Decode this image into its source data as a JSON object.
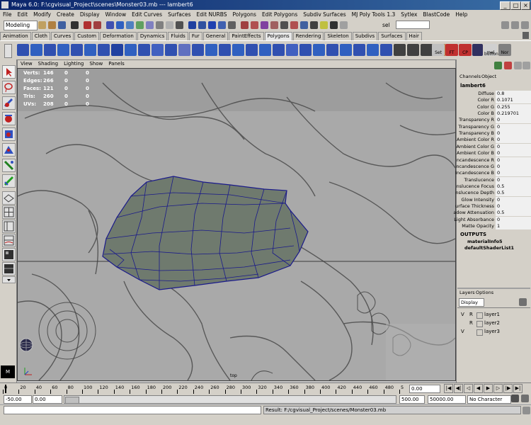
{
  "window": {
    "title": "Maya 6.0: F:\\cgvisual_Project\\scenes\\Monster03.mb  ---  lambert6"
  },
  "menu": [
    "File",
    "Edit",
    "Modify",
    "Create",
    "Display",
    "Window",
    "Edit Curves",
    "Surfaces",
    "Edit NURBS",
    "Polygons",
    "Edit Polygons",
    "Subdiv Surfaces",
    "MJ Poly Tools 1.3",
    "Sytlex",
    "BlastCode",
    "Help"
  ],
  "status": {
    "mode": "Modeling",
    "sel_label": "sel"
  },
  "shelf_tabs": [
    "Animation",
    "Cloth",
    "Curves",
    "Custom",
    "Deformation",
    "Dynamics",
    "Fluids",
    "Fur",
    "General",
    "PaintEffects",
    "Polygons",
    "Rendering",
    "Skeleton",
    "Subdivs",
    "Surfaces",
    "Hair"
  ],
  "shelf_active": "Polygons",
  "shelf_text_icons": {
    "set": "Set",
    "ft": "FT",
    "cp": "CP",
    "mel": "mel",
    "button": "button",
    "nor": "Nor"
  },
  "panel_menu": [
    "View",
    "Shading",
    "Lighting",
    "Show",
    "Panels"
  ],
  "hud": [
    {
      "label": "Verts:",
      "v1": "146",
      "v2": "0",
      "v3": "0"
    },
    {
      "label": "Edges:",
      "v1": "266",
      "v2": "0",
      "v3": "0"
    },
    {
      "label": "Faces:",
      "v1": "121",
      "v2": "0",
      "v3": "0"
    },
    {
      "label": "Tris:",
      "v1": "260",
      "v2": "0",
      "v3": "0"
    },
    {
      "label": "UVs:",
      "v1": "208",
      "v2": "0",
      "v3": "0"
    }
  ],
  "viewport_label": "top",
  "channel_box": {
    "tabs": [
      "Channels",
      "Object"
    ],
    "node": "lambert6",
    "attributes": [
      {
        "name": "Diffuse",
        "value": "0.8"
      },
      {
        "name": "Color R",
        "value": "0.1071"
      },
      {
        "name": "Color G",
        "value": "0.255"
      },
      {
        "name": "Color B",
        "value": "0.219701"
      },
      {
        "name": "Transparency R",
        "value": "0"
      },
      {
        "name": "Transparency G",
        "value": "0"
      },
      {
        "name": "Transparency B",
        "value": "0"
      },
      {
        "name": "Ambient Color R",
        "value": "0"
      },
      {
        "name": "Ambient Color G",
        "value": "0"
      },
      {
        "name": "Ambient Color B",
        "value": "0"
      },
      {
        "name": "ncandescence R",
        "value": "0"
      },
      {
        "name": "ncandescence G",
        "value": "0"
      },
      {
        "name": "Incandescence B",
        "value": "0"
      },
      {
        "name": "Translucence",
        "value": "0"
      },
      {
        "name": "nslucence Focus",
        "value": "0.5"
      },
      {
        "name": "nslucence Depth",
        "value": "0.5"
      },
      {
        "name": "Glow Intensity",
        "value": "0"
      },
      {
        "name": "urface Thickness",
        "value": "0"
      },
      {
        "name": "adow Attenuation",
        "value": "0.5"
      },
      {
        "name": "Light Absorbance",
        "value": "0"
      },
      {
        "name": "Matte Opacity",
        "value": "1"
      }
    ],
    "outputs_header": "OUTPUTS",
    "outputs": [
      "materialInfo5",
      "defaultShaderList1"
    ]
  },
  "layers": {
    "tabs": [
      "Layers",
      "Options"
    ],
    "dropdown": "Display",
    "items": [
      {
        "v": "V",
        "r": "R",
        "name": "layer1"
      },
      {
        "v": "",
        "r": "R",
        "name": "layer2"
      },
      {
        "v": "V",
        "r": "",
        "name": "layer3"
      }
    ]
  },
  "timeline": {
    "ticks": [
      "0",
      "20",
      "40",
      "60",
      "80",
      "100",
      "120",
      "140",
      "160",
      "180",
      "200",
      "220",
      "240",
      "260",
      "280",
      "300",
      "320",
      "340",
      "360",
      "380",
      "400",
      "420",
      "440",
      "460",
      "480",
      "5"
    ],
    "current": "0.00"
  },
  "range": {
    "start": "-50.00",
    "playstart": "0.00",
    "playend": "500.00",
    "end": "50000.00",
    "character": "No Character Set"
  },
  "help_line": "Result: F:/cgvisual_Project/scenes/Monster03.mb"
}
